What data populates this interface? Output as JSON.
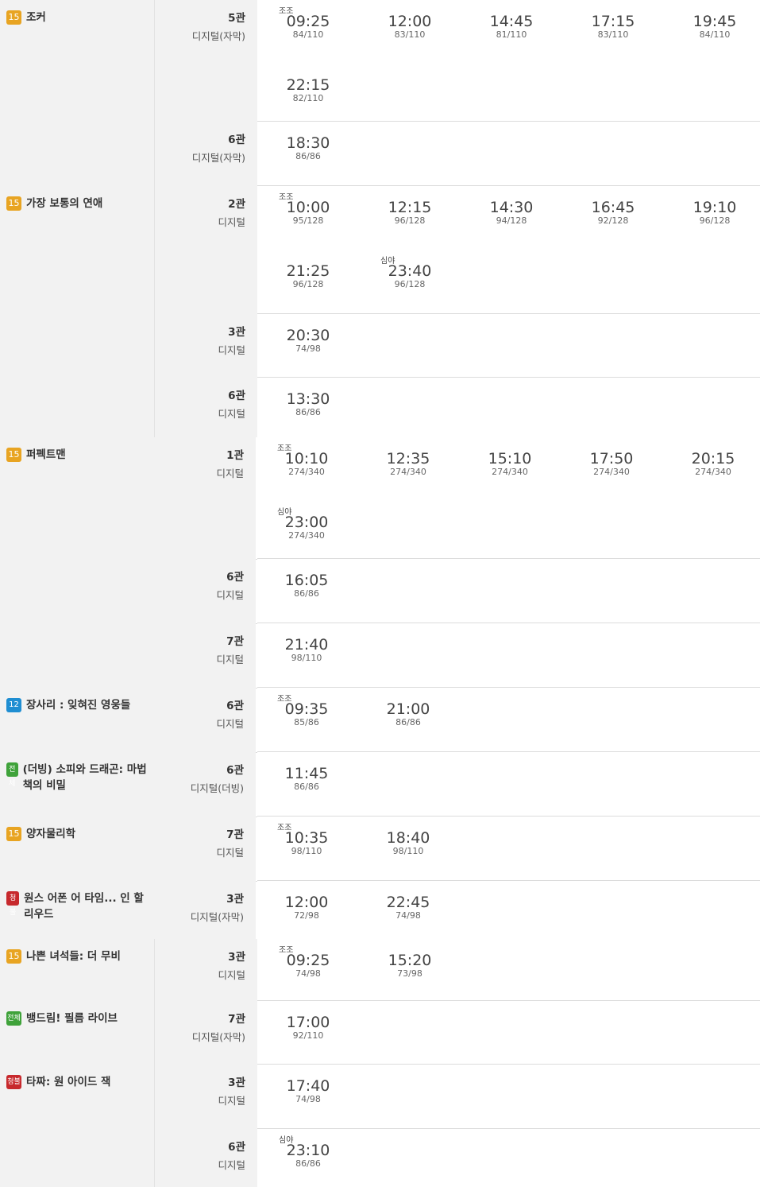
{
  "badge_labels": {
    "15": "15",
    "12": "12",
    "all": "전체",
    "adult": "청불"
  },
  "rows": [
    {
      "title": "조커",
      "badge": "15",
      "screen": "5관",
      "format": "디지털(자막)",
      "times": [
        {
          "tag": "조조",
          "time": "09:25",
          "seats": "84/110"
        },
        {
          "time": "12:00",
          "seats": "83/110"
        },
        {
          "time": "14:45",
          "seats": "81/110"
        },
        {
          "time": "17:15",
          "seats": "83/110"
        },
        {
          "time": "19:45",
          "seats": "84/110"
        },
        {
          "time": "22:15",
          "seats": "82/110"
        }
      ]
    },
    {
      "title": "",
      "screen": "6관",
      "format": "디지털(자막)",
      "times": [
        {
          "time": "18:30",
          "seats": "86/86"
        }
      ]
    },
    {
      "title": "가장 보통의 연애",
      "badge": "15",
      "screen": "2관",
      "format": "디지털",
      "times": [
        {
          "tag": "조조",
          "time": "10:00",
          "seats": "95/128"
        },
        {
          "time": "12:15",
          "seats": "96/128"
        },
        {
          "time": "14:30",
          "seats": "94/128"
        },
        {
          "time": "16:45",
          "seats": "92/128"
        },
        {
          "time": "19:10",
          "seats": "96/128"
        },
        {
          "time": "21:25",
          "seats": "96/128"
        },
        {
          "tag": "심야",
          "time": "23:40",
          "seats": "96/128"
        }
      ]
    },
    {
      "title": "",
      "screen": "3관",
      "format": "디지털",
      "times": [
        {
          "time": "20:30",
          "seats": "74/98"
        }
      ]
    },
    {
      "title": "",
      "screen": "6관",
      "format": "디지털",
      "times": [
        {
          "time": "13:30",
          "seats": "86/86"
        }
      ]
    },
    {
      "title": "퍼펙트맨",
      "badge": "15",
      "screen": "1관",
      "format": "디지털",
      "times": [
        {
          "tag": "조조",
          "time": "10:10",
          "seats": "274/340"
        },
        {
          "time": "12:35",
          "seats": "274/340"
        },
        {
          "time": "15:10",
          "seats": "274/340"
        },
        {
          "time": "17:50",
          "seats": "274/340"
        },
        {
          "time": "20:15",
          "seats": "274/340"
        },
        {
          "tag": "심야",
          "time": "23:00",
          "seats": "274/340"
        }
      ]
    },
    {
      "title": "",
      "screen": "6관",
      "format": "디지털",
      "times": [
        {
          "time": "16:05",
          "seats": "86/86"
        }
      ]
    },
    {
      "title": "",
      "screen": "7관",
      "format": "디지털",
      "times": [
        {
          "time": "21:40",
          "seats": "98/110"
        }
      ]
    },
    {
      "title": "장사리 : 잊혀진 영웅들",
      "badge": "12",
      "screen": "6관",
      "format": "디지털",
      "times": [
        {
          "tag": "조조",
          "time": "09:35",
          "seats": "85/86"
        },
        {
          "time": "21:00",
          "seats": "86/86"
        }
      ]
    },
    {
      "title": "(더빙) 소피와 드래곤: 마법책의 비밀",
      "badge": "all",
      "screen": "6관",
      "format": "디지털(더빙)",
      "times": [
        {
          "time": "11:45",
          "seats": "86/86"
        }
      ]
    },
    {
      "title": "양자물리학",
      "badge": "15",
      "screen": "7관",
      "format": "디지털",
      "times": [
        {
          "tag": "조조",
          "time": "10:35",
          "seats": "98/110"
        },
        {
          "time": "18:40",
          "seats": "98/110"
        }
      ]
    },
    {
      "title": "원스 어폰 어 타임... 인 할리우드",
      "badge": "adult",
      "screen": "3관",
      "format": "디지털(자막)",
      "times": [
        {
          "time": "12:00",
          "seats": "72/98"
        },
        {
          "time": "22:45",
          "seats": "74/98"
        }
      ]
    },
    {
      "title": "나쁜 녀석들: 더 무비",
      "badge": "15",
      "screen": "3관",
      "format": "디지털",
      "times": [
        {
          "tag": "조조",
          "time": "09:25",
          "seats": "74/98"
        },
        {
          "time": "15:20",
          "seats": "73/98"
        }
      ]
    },
    {
      "title": "뱅드림! 필름 라이브",
      "badge": "all",
      "screen": "7관",
      "format": "디지털(자막)",
      "times": [
        {
          "time": "17:00",
          "seats": "92/110"
        }
      ]
    },
    {
      "title": "타짜: 원 아이드 잭",
      "badge": "adult",
      "screen": "3관",
      "format": "디지털",
      "times": [
        {
          "time": "17:40",
          "seats": "74/98"
        }
      ]
    },
    {
      "title": "",
      "screen": "6관",
      "format": "디지털",
      "times": [
        {
          "tag": "심야",
          "time": "23:10",
          "seats": "86/86"
        }
      ]
    }
  ]
}
